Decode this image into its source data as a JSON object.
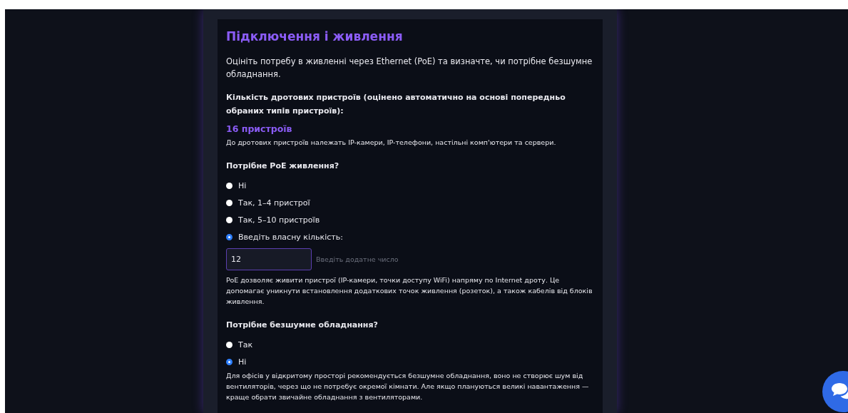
{
  "title": "Підключення і живлення",
  "intro": "Оцініть потребу в живленні через Ethernet (PoE) та визначте, чи потрібне безшумне обладнання.",
  "wired": {
    "label": "Кількість дротових пристроїв (оцінено автоматично на основі попередньо обраних типів пристроїв):",
    "count": "16 пристроїв",
    "note": "До дротових пристроїв належать IP-камери, IP-телефони, настільні комп'ютери та сервери."
  },
  "poe": {
    "question": "Потрібне PoE живлення?",
    "options": [
      {
        "label": "Ні",
        "selected": false
      },
      {
        "label": "Так, 1–4 пристрої",
        "selected": false
      },
      {
        "label": "Так, 5–10 пристроїв",
        "selected": false
      },
      {
        "label": "Введіть власну кількість:",
        "selected": true
      }
    ],
    "custom_value": "12",
    "hint": "Введіть додатне число",
    "note": "PoE дозволяє живити пристрої (IP-камери, точки доступу WiFi) напряму по Internet дроту. Це допомагає уникнути встановлення додаткових точок живлення (розеток), а також кабелів від блоків живлення."
  },
  "silent": {
    "question": "Потрібне безшумне обладнання?",
    "options": [
      {
        "label": "Так",
        "selected": false
      },
      {
        "label": "Ні",
        "selected": true
      }
    ],
    "note": "Для офісів у відкритому просторі рекомендується безшумне обладнання, воно не створює шум від вентиляторів, через що не потребує окремої кімнати. Але якщо плануються великі навантаження — краще обрати звичайне обладнання з вентиляторами."
  }
}
